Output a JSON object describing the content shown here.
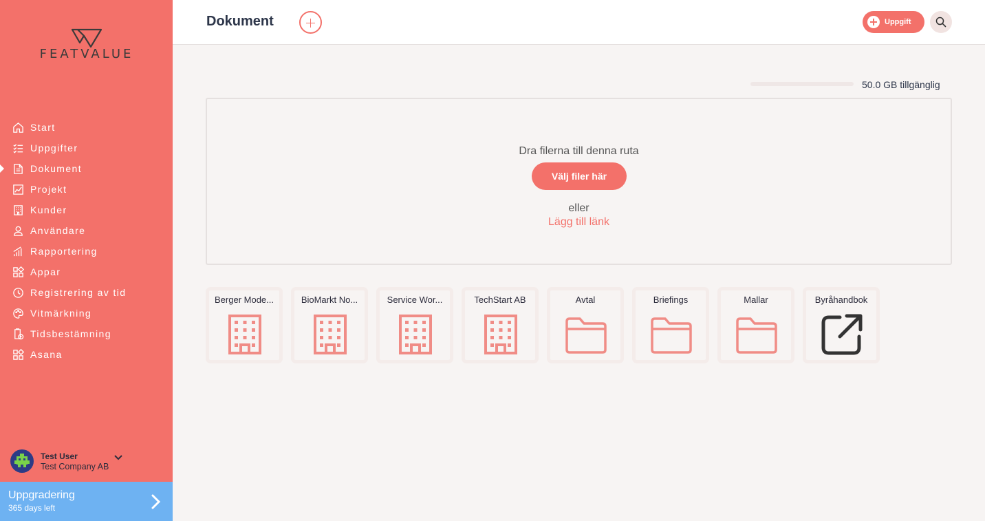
{
  "brand": {
    "name": "FEATVALUE"
  },
  "header": {
    "title": "Dokument",
    "task_label": "Uppgift"
  },
  "sidebar": {
    "items": [
      {
        "label": "Start",
        "icon": "home-icon"
      },
      {
        "label": "Uppgifter",
        "icon": "checklist-icon"
      },
      {
        "label": "Dokument",
        "icon": "document-icon",
        "active": true
      },
      {
        "label": "Projekt",
        "icon": "chart-icon"
      },
      {
        "label": "Kunder",
        "icon": "building-icon"
      },
      {
        "label": "Användare",
        "icon": "user-icon"
      },
      {
        "label": "Rapportering",
        "icon": "bars-icon"
      },
      {
        "label": "Appar",
        "icon": "apps-icon"
      },
      {
        "label": "Registrering av tid",
        "icon": "clock-icon"
      },
      {
        "label": "Vitmärkning",
        "icon": "palette-icon"
      },
      {
        "label": "Tidsbestämning",
        "icon": "timer-icon"
      },
      {
        "label": "Asana",
        "icon": "apps-icon"
      }
    ]
  },
  "user": {
    "name": "Test User",
    "company": "Test Company AB"
  },
  "upgrade": {
    "title": "Uppgradering",
    "subtitle": "365 days left"
  },
  "storage": {
    "text": "50.0 GB tillgänglig"
  },
  "dropzone": {
    "drag_text": "Dra filerna till denna ruta",
    "choose_label": "Välj filer här",
    "or_text": "eller",
    "link_label": "Lägg till länk"
  },
  "tiles": [
    {
      "name": "Berger Mode...",
      "icon": "building-icon"
    },
    {
      "name": "BioMarkt No...",
      "icon": "building-icon"
    },
    {
      "name": "Service Wor...",
      "icon": "building-icon"
    },
    {
      "name": "TechStart AB",
      "icon": "building-icon"
    },
    {
      "name": "Avtal",
      "icon": "folder-icon"
    },
    {
      "name": "Briefings",
      "icon": "folder-icon"
    },
    {
      "name": "Mallar",
      "icon": "folder-icon"
    },
    {
      "name": "Byråhandbok",
      "icon": "external-link-icon"
    }
  ],
  "colors": {
    "accent": "#f3716a",
    "upgrade": "#6eb2f2",
    "tile_icon": "#f08c86"
  }
}
